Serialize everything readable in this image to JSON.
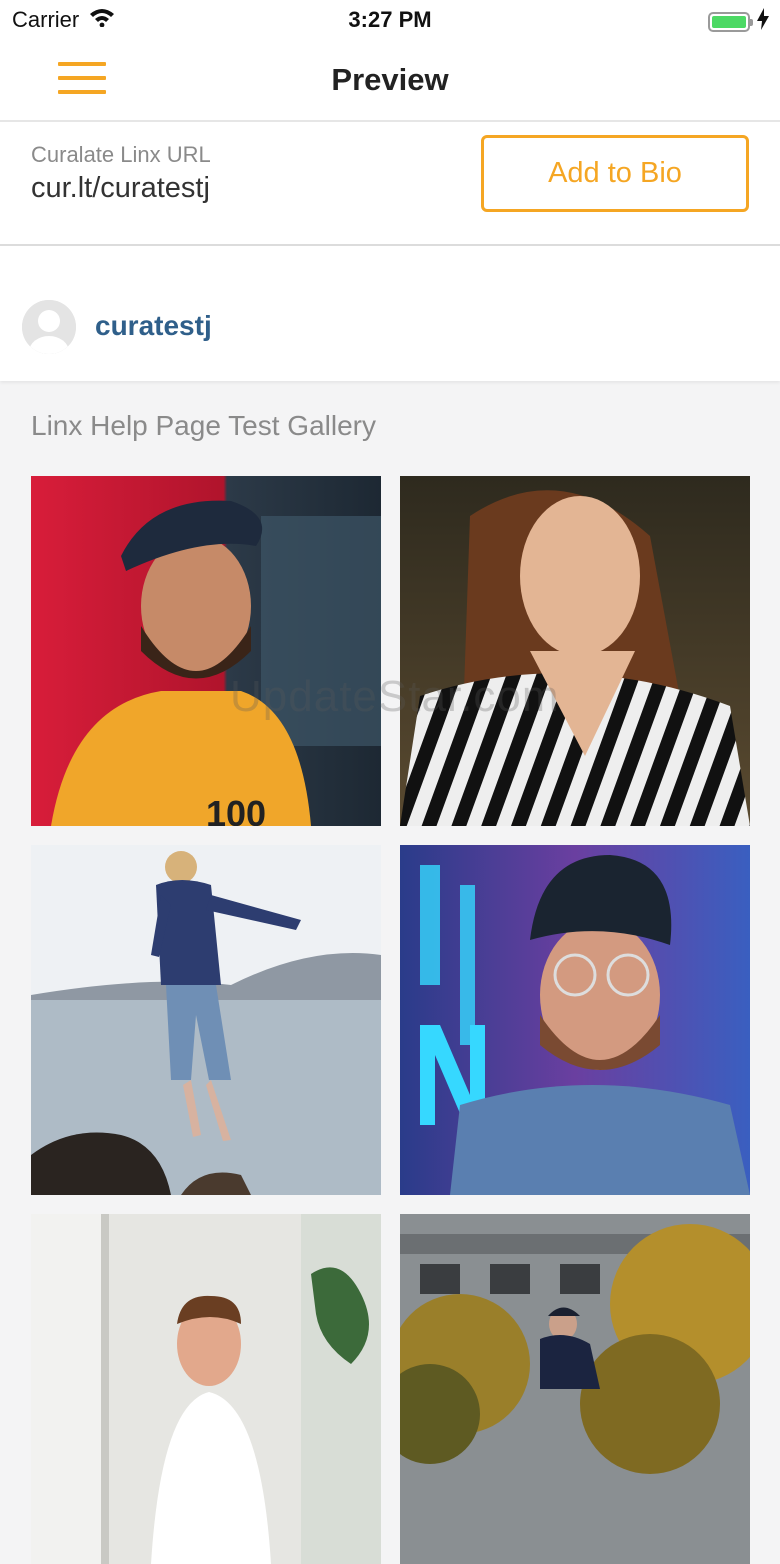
{
  "status_bar": {
    "carrier": "Carrier",
    "time": "3:27 PM",
    "icons": [
      "wifi-icon",
      "battery-icon",
      "charging-bolt-icon"
    ]
  },
  "nav": {
    "title": "Preview",
    "menu_icon": "hamburger-menu-icon",
    "accent": "#f5a623"
  },
  "linx": {
    "label": "Curalate Linx URL",
    "url": "cur.lt/curatestj",
    "add_button": "Add to Bio"
  },
  "profile": {
    "username": "curatestj",
    "avatar_icon": "default-avatar-icon",
    "username_color": "#2f5f8a"
  },
  "gallery": {
    "title": "Linx Help Page Test Gallery",
    "photos": [
      "man-in-cap-yellow-tee",
      "woman-striped-shirt",
      "man-jumping-over-water",
      "man-beanie-neon-light",
      "smiling-man-indoor",
      "man-walking-among-trees"
    ]
  },
  "watermark": "UpdateStar.com"
}
